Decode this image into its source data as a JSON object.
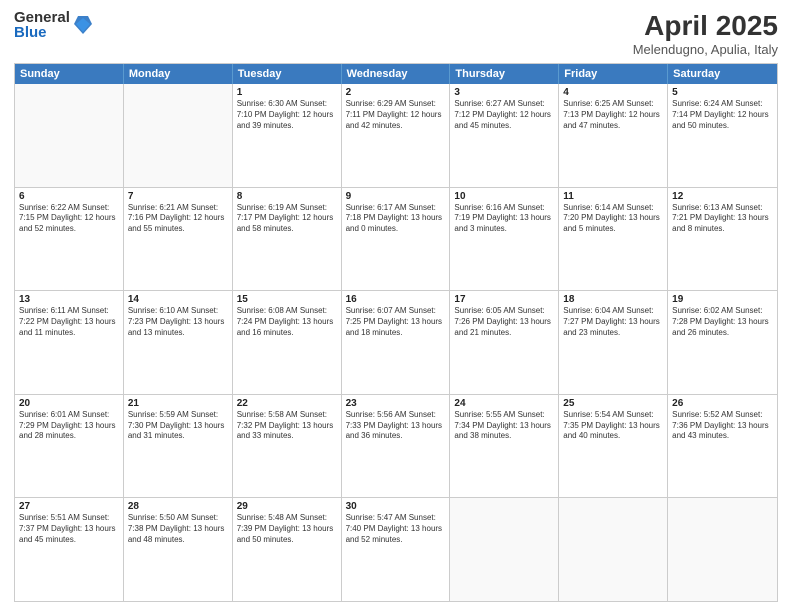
{
  "logo": {
    "general": "General",
    "blue": "Blue"
  },
  "title": {
    "month": "April 2025",
    "location": "Melendugno, Apulia, Italy"
  },
  "days": [
    "Sunday",
    "Monday",
    "Tuesday",
    "Wednesday",
    "Thursday",
    "Friday",
    "Saturday"
  ],
  "rows": [
    [
      {
        "day": "",
        "info": ""
      },
      {
        "day": "",
        "info": ""
      },
      {
        "day": "1",
        "info": "Sunrise: 6:30 AM\nSunset: 7:10 PM\nDaylight: 12 hours and 39 minutes."
      },
      {
        "day": "2",
        "info": "Sunrise: 6:29 AM\nSunset: 7:11 PM\nDaylight: 12 hours and 42 minutes."
      },
      {
        "day": "3",
        "info": "Sunrise: 6:27 AM\nSunset: 7:12 PM\nDaylight: 12 hours and 45 minutes."
      },
      {
        "day": "4",
        "info": "Sunrise: 6:25 AM\nSunset: 7:13 PM\nDaylight: 12 hours and 47 minutes."
      },
      {
        "day": "5",
        "info": "Sunrise: 6:24 AM\nSunset: 7:14 PM\nDaylight: 12 hours and 50 minutes."
      }
    ],
    [
      {
        "day": "6",
        "info": "Sunrise: 6:22 AM\nSunset: 7:15 PM\nDaylight: 12 hours and 52 minutes."
      },
      {
        "day": "7",
        "info": "Sunrise: 6:21 AM\nSunset: 7:16 PM\nDaylight: 12 hours and 55 minutes."
      },
      {
        "day": "8",
        "info": "Sunrise: 6:19 AM\nSunset: 7:17 PM\nDaylight: 12 hours and 58 minutes."
      },
      {
        "day": "9",
        "info": "Sunrise: 6:17 AM\nSunset: 7:18 PM\nDaylight: 13 hours and 0 minutes."
      },
      {
        "day": "10",
        "info": "Sunrise: 6:16 AM\nSunset: 7:19 PM\nDaylight: 13 hours and 3 minutes."
      },
      {
        "day": "11",
        "info": "Sunrise: 6:14 AM\nSunset: 7:20 PM\nDaylight: 13 hours and 5 minutes."
      },
      {
        "day": "12",
        "info": "Sunrise: 6:13 AM\nSunset: 7:21 PM\nDaylight: 13 hours and 8 minutes."
      }
    ],
    [
      {
        "day": "13",
        "info": "Sunrise: 6:11 AM\nSunset: 7:22 PM\nDaylight: 13 hours and 11 minutes."
      },
      {
        "day": "14",
        "info": "Sunrise: 6:10 AM\nSunset: 7:23 PM\nDaylight: 13 hours and 13 minutes."
      },
      {
        "day": "15",
        "info": "Sunrise: 6:08 AM\nSunset: 7:24 PM\nDaylight: 13 hours and 16 minutes."
      },
      {
        "day": "16",
        "info": "Sunrise: 6:07 AM\nSunset: 7:25 PM\nDaylight: 13 hours and 18 minutes."
      },
      {
        "day": "17",
        "info": "Sunrise: 6:05 AM\nSunset: 7:26 PM\nDaylight: 13 hours and 21 minutes."
      },
      {
        "day": "18",
        "info": "Sunrise: 6:04 AM\nSunset: 7:27 PM\nDaylight: 13 hours and 23 minutes."
      },
      {
        "day": "19",
        "info": "Sunrise: 6:02 AM\nSunset: 7:28 PM\nDaylight: 13 hours and 26 minutes."
      }
    ],
    [
      {
        "day": "20",
        "info": "Sunrise: 6:01 AM\nSunset: 7:29 PM\nDaylight: 13 hours and 28 minutes."
      },
      {
        "day": "21",
        "info": "Sunrise: 5:59 AM\nSunset: 7:30 PM\nDaylight: 13 hours and 31 minutes."
      },
      {
        "day": "22",
        "info": "Sunrise: 5:58 AM\nSunset: 7:32 PM\nDaylight: 13 hours and 33 minutes."
      },
      {
        "day": "23",
        "info": "Sunrise: 5:56 AM\nSunset: 7:33 PM\nDaylight: 13 hours and 36 minutes."
      },
      {
        "day": "24",
        "info": "Sunrise: 5:55 AM\nSunset: 7:34 PM\nDaylight: 13 hours and 38 minutes."
      },
      {
        "day": "25",
        "info": "Sunrise: 5:54 AM\nSunset: 7:35 PM\nDaylight: 13 hours and 40 minutes."
      },
      {
        "day": "26",
        "info": "Sunrise: 5:52 AM\nSunset: 7:36 PM\nDaylight: 13 hours and 43 minutes."
      }
    ],
    [
      {
        "day": "27",
        "info": "Sunrise: 5:51 AM\nSunset: 7:37 PM\nDaylight: 13 hours and 45 minutes."
      },
      {
        "day": "28",
        "info": "Sunrise: 5:50 AM\nSunset: 7:38 PM\nDaylight: 13 hours and 48 minutes."
      },
      {
        "day": "29",
        "info": "Sunrise: 5:48 AM\nSunset: 7:39 PM\nDaylight: 13 hours and 50 minutes."
      },
      {
        "day": "30",
        "info": "Sunrise: 5:47 AM\nSunset: 7:40 PM\nDaylight: 13 hours and 52 minutes."
      },
      {
        "day": "",
        "info": ""
      },
      {
        "day": "",
        "info": ""
      },
      {
        "day": "",
        "info": ""
      }
    ]
  ]
}
